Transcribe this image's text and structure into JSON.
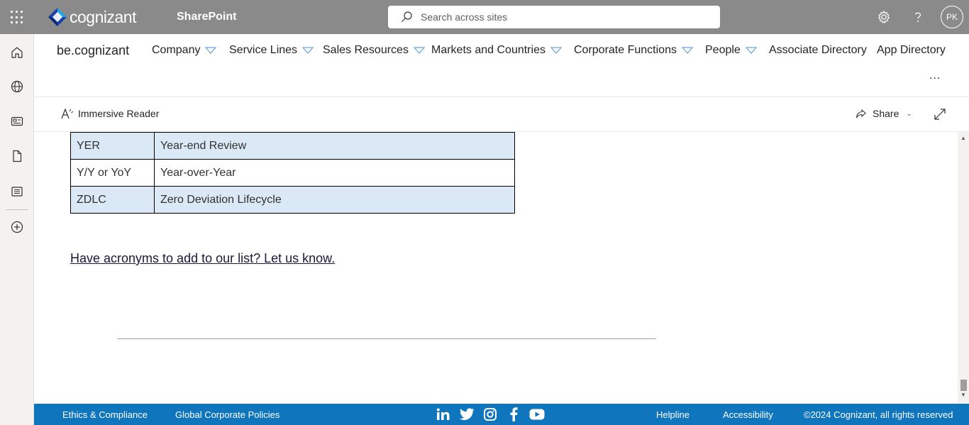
{
  "suite": {
    "brand": "cognizant",
    "app": "SharePoint",
    "search_placeholder": "Search across sites",
    "avatar_initials": "PK"
  },
  "site": {
    "name": "be.cognizant",
    "nav": [
      {
        "label": "Company",
        "has_menu": true
      },
      {
        "label": "Service Lines",
        "has_menu": true
      },
      {
        "label": "Sales Resources",
        "has_menu": true
      },
      {
        "label": "Markets and Countries",
        "has_menu": true
      },
      {
        "label": "Corporate Functions",
        "has_menu": true
      },
      {
        "label": "People",
        "has_menu": true
      },
      {
        "label": "Associate Directory",
        "has_menu": false
      },
      {
        "label": "App Directory",
        "has_menu": false
      }
    ],
    "more": "..."
  },
  "commandbar": {
    "immersive_reader": "Immersive Reader",
    "share": "Share"
  },
  "acronyms": [
    {
      "term": "YER",
      "meaning": "Year-end Review"
    },
    {
      "term": "Y/Y or YoY",
      "meaning": "Year-over-Year"
    },
    {
      "term": "ZDLC",
      "meaning": "Zero Deviation Lifecycle"
    }
  ],
  "cta_link": "Have acronyms to add to our list?  Let us know.",
  "footer": {
    "ethics": "Ethics & Compliance",
    "policies": "Global Corporate Policies",
    "helpline": "Helpline",
    "accessibility": "Accessibility",
    "copyright": "©2024 Cognizant, all rights reserved",
    "social": [
      "linkedin-icon",
      "twitter-icon",
      "instagram-icon",
      "facebook-icon",
      "youtube-icon"
    ]
  },
  "colors": {
    "topbar": "#8a8a8a",
    "footer": "#0f75bc",
    "table_shade": "#dbe9f7",
    "nav_caret": "#6fa8dc"
  }
}
